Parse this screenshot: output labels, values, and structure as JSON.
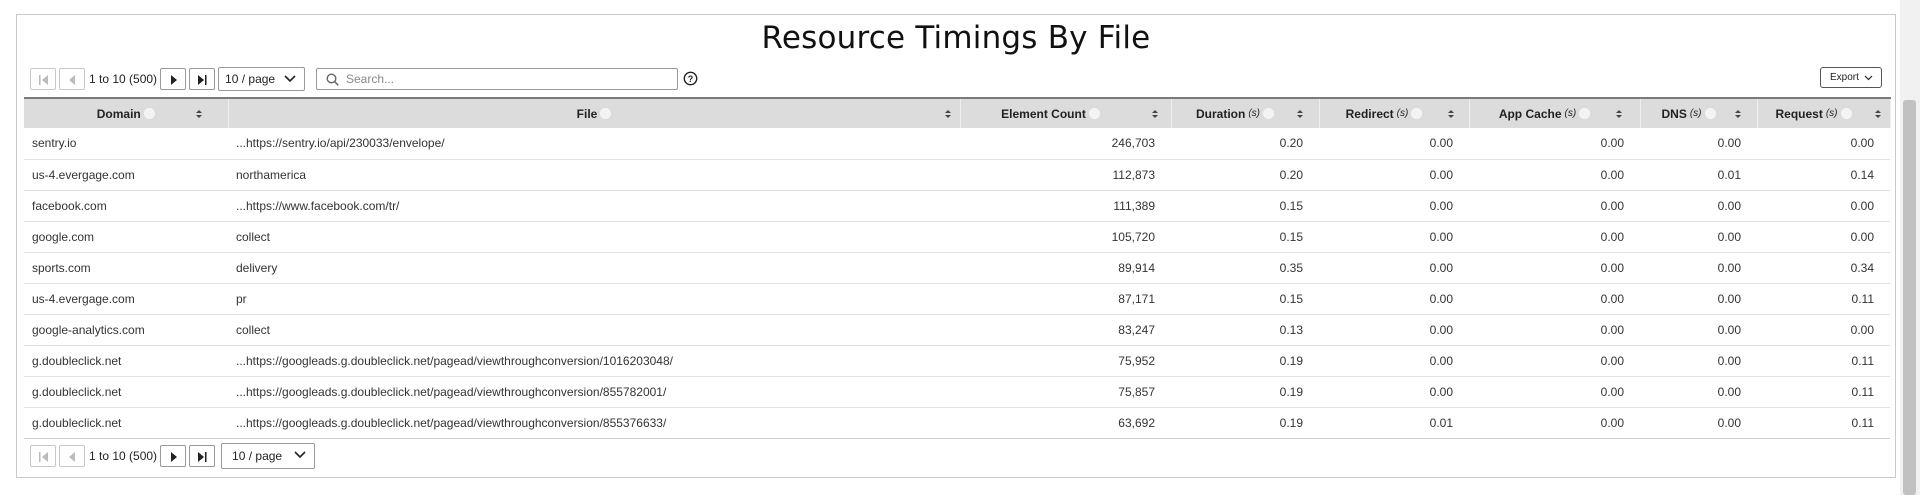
{
  "title": "Resource Timings By File",
  "pager": {
    "range_text": "1 to 10 (500)",
    "page_size": "10 / page"
  },
  "search": {
    "placeholder": "Search..."
  },
  "export_label": "Export",
  "columns": [
    {
      "label": "Domain",
      "unit": ""
    },
    {
      "label": "File",
      "unit": ""
    },
    {
      "label": "Element Count",
      "unit": ""
    },
    {
      "label": "Duration",
      "unit": "(s)"
    },
    {
      "label": "Redirect",
      "unit": "(s)"
    },
    {
      "label": "App Cache",
      "unit": "(s)"
    },
    {
      "label": "DNS",
      "unit": "(s)"
    },
    {
      "label": "Request",
      "unit": "(s)"
    }
  ],
  "rows": [
    [
      "sentry.io",
      "...https://sentry.io/api/230033/envelope/",
      "246,703",
      "0.20",
      "0.00",
      "0.00",
      "0.00",
      "0.00"
    ],
    [
      "us-4.evergage.com",
      "northamerica",
      "112,873",
      "0.20",
      "0.00",
      "0.00",
      "0.01",
      "0.14"
    ],
    [
      "facebook.com",
      "...https://www.facebook.com/tr/",
      "111,389",
      "0.15",
      "0.00",
      "0.00",
      "0.00",
      "0.00"
    ],
    [
      "google.com",
      "collect",
      "105,720",
      "0.15",
      "0.00",
      "0.00",
      "0.00",
      "0.00"
    ],
    [
      "sports.com",
      "delivery",
      "89,914",
      "0.35",
      "0.00",
      "0.00",
      "0.00",
      "0.34"
    ],
    [
      "us-4.evergage.com",
      "pr",
      "87,171",
      "0.15",
      "0.00",
      "0.00",
      "0.00",
      "0.11"
    ],
    [
      "google-analytics.com",
      "collect",
      "83,247",
      "0.13",
      "0.00",
      "0.00",
      "0.00",
      "0.00"
    ],
    [
      "g.doubleclick.net",
      "...https://googleads.g.doubleclick.net/pagead/viewthroughconversion/1016203048/",
      "75,952",
      "0.19",
      "0.00",
      "0.00",
      "0.00",
      "0.11"
    ],
    [
      "g.doubleclick.net",
      "...https://googleads.g.doubleclick.net/pagead/viewthroughconversion/855782001/",
      "75,857",
      "0.19",
      "0.00",
      "0.00",
      "0.00",
      "0.11"
    ],
    [
      "g.doubleclick.net",
      "...https://googleads.g.doubleclick.net/pagead/viewthroughconversion/855376633/",
      "63,692",
      "0.19",
      "0.01",
      "0.00",
      "0.00",
      "0.11"
    ]
  ]
}
